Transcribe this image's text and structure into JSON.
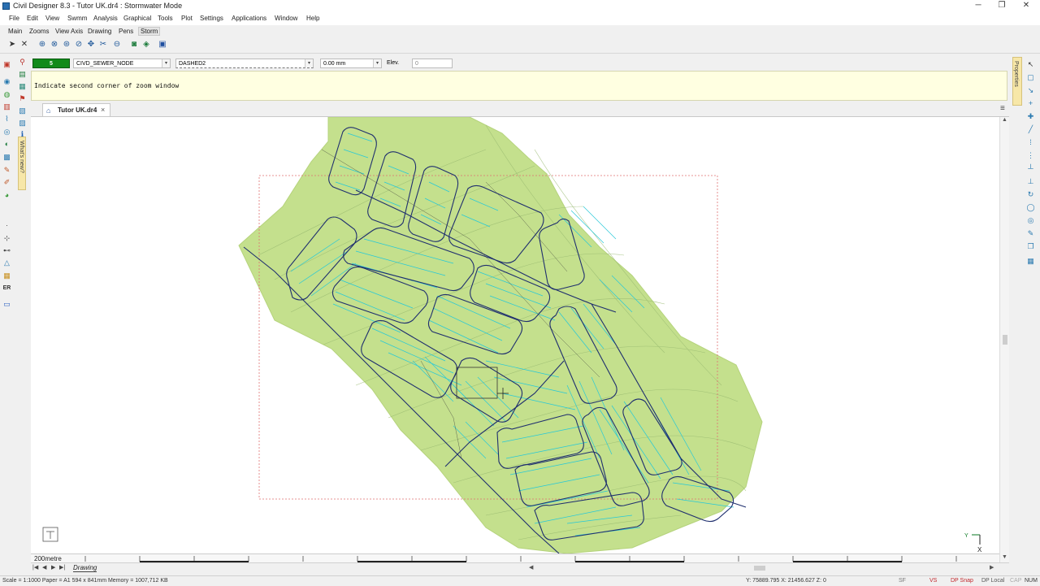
{
  "window": {
    "title": "Civil Designer 8.3 - Tutor UK.dr4 : Stormwater Mode",
    "minimize": "─",
    "restore": "❐",
    "close": "✕"
  },
  "menu": [
    "File",
    "Edit",
    "View",
    "Swmm",
    "Analysis",
    "Graphical",
    "Tools",
    "Plot",
    "Settings",
    "Applications",
    "Window",
    "Help"
  ],
  "ribbon_tabs": [
    "Main",
    "Zooms",
    "View Axis",
    "Drawing",
    "Pens",
    "Storm"
  ],
  "properties_bar": {
    "colour_value": "5",
    "layer": "CIVD_SEWER_NODE",
    "linetype": "DASHED2",
    "thickness": "0.00 mm",
    "elev_label": "Elev.",
    "elev_value": "0"
  },
  "command_prompt": "Indicate second corner of zoom window",
  "whats_new_label": "What's new?",
  "properties_panel_label": "Properties",
  "document_tab": {
    "title": "Tutor UK.dr4",
    "close": "×"
  },
  "scale_label": "200metre",
  "sheet_tab": "Drawing",
  "status": {
    "left": "Scale = 1:1000   Paper = A1 594 x 841mm   Memory = 1007,712 KB",
    "coords": "Y: 75889.795 X: 21456.627 Z: 0",
    "sf": "SF",
    "vs": "VS",
    "dp_snap": "DP Snap",
    "dp_local": "DP Local",
    "cap": "CAP",
    "num": "NUM"
  },
  "axis": {
    "y": "Y",
    "x": "X"
  },
  "colors": {
    "terrain": "#c4e08d",
    "roads": "#1f2f6e",
    "plots": "#25c8d8",
    "contours": "#8fae6a",
    "accent": "#0a7a22",
    "status_red": "#c0282c"
  }
}
